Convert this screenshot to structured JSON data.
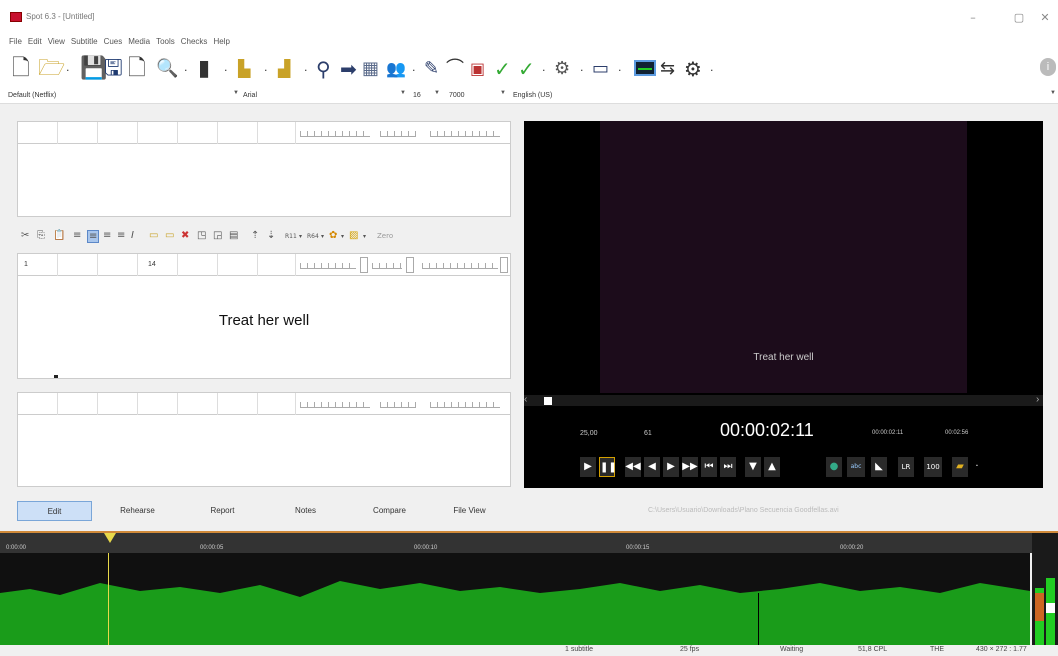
{
  "window": {
    "title": "Spot 6.3 - [Untitled]",
    "min": "–",
    "max": "▢",
    "close": "✕"
  },
  "menu": [
    "File",
    "Edit",
    "View",
    "Subtitle",
    "Cues",
    "Media",
    "Tools",
    "Checks",
    "Help"
  ],
  "format": {
    "preset": "Default (Netflix)",
    "font": "Arial",
    "size": "16",
    "width": "7000",
    "language": "English (US)"
  },
  "current": {
    "number": "1",
    "chars": "14",
    "text": "Treat her well"
  },
  "edit_tools": {
    "r11": "R11",
    "r64": "R64",
    "zero": "Zero"
  },
  "video": {
    "subtitle": "Treat her well",
    "fps": "25,00",
    "frame": "61",
    "timecode": "00:00:02:11",
    "tc_small": "00:00:02:11",
    "tc_dur": "00:02:56",
    "lr": "LR",
    "hundred": "100"
  },
  "tabs": [
    "Edit",
    "Rehearse",
    "Report",
    "Notes",
    "Compare",
    "File View"
  ],
  "file_path": "C:\\Users\\Usuario\\Downloads\\Plano Secuencia Goodfellas.avi",
  "timeline": {
    "ticks": [
      "0:00:00",
      "00:00:05",
      "00:00:10",
      "00:00:15",
      "00:00:20"
    ]
  },
  "status": {
    "s1": "1 subtitle",
    "s2": "25 fps",
    "s3": "Waiting",
    "s4": "51,8 CPL",
    "s5": "THE",
    "s6": "430 × 272 : 1.77"
  },
  "colors": {
    "accent": "#2f5fa7",
    "waveform": "#1a9c1a",
    "playhead": "#e8d94a"
  }
}
